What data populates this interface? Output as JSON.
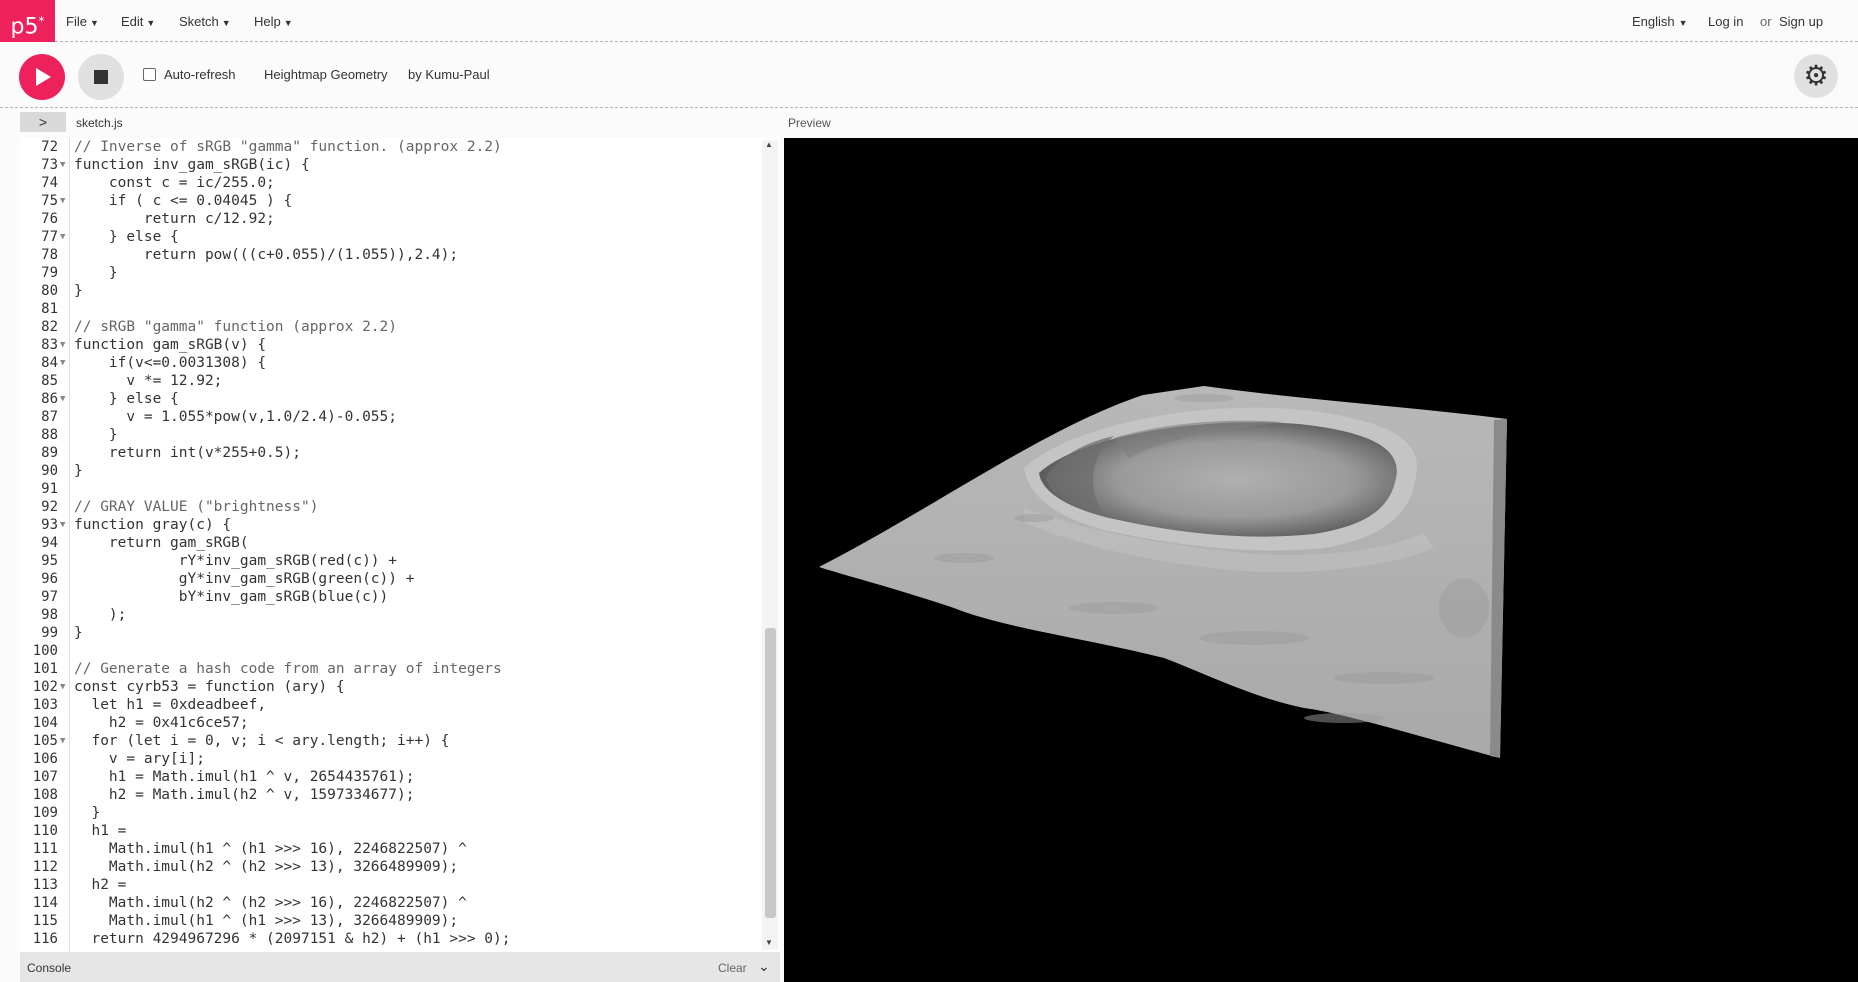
{
  "nav": {
    "logo": "p5",
    "logo_sup": "*",
    "menus": [
      "File",
      "Edit",
      "Sketch",
      "Help"
    ],
    "language": "English",
    "login": "Log in",
    "or": "or",
    "signup": "Sign up"
  },
  "toolbar": {
    "auto_refresh_label": "Auto-refresh",
    "auto_refresh_checked": false,
    "sketch_name": "Heightmap Geometry",
    "sketch_owner": "by Kumu-Paul"
  },
  "editor": {
    "file_name": "sketch.js",
    "preview_label": "Preview",
    "lines": [
      {
        "n": "72",
        "fold": "",
        "text": "// Inverse of sRGB \"gamma\" function. (approx 2.2)"
      },
      {
        "n": "73",
        "fold": "▼",
        "text": "function inv_gam_sRGB(ic) {"
      },
      {
        "n": "74",
        "fold": "",
        "text": "    const c = ic/255.0;"
      },
      {
        "n": "75",
        "fold": "▼",
        "text": "    if ( c <= 0.04045 ) {"
      },
      {
        "n": "76",
        "fold": "",
        "text": "        return c/12.92;"
      },
      {
        "n": "77",
        "fold": "▼",
        "text": "    } else {"
      },
      {
        "n": "78",
        "fold": "",
        "text": "        return pow(((c+0.055)/(1.055)),2.4);"
      },
      {
        "n": "79",
        "fold": "",
        "text": "    }"
      },
      {
        "n": "80",
        "fold": "",
        "text": "}"
      },
      {
        "n": "81",
        "fold": "",
        "text": ""
      },
      {
        "n": "82",
        "fold": "",
        "text": "// sRGB \"gamma\" function (approx 2.2)"
      },
      {
        "n": "83",
        "fold": "▼",
        "text": "function gam_sRGB(v) {"
      },
      {
        "n": "84",
        "fold": "▼",
        "text": "    if(v<=0.0031308) {"
      },
      {
        "n": "85",
        "fold": "",
        "text": "      v *= 12.92;"
      },
      {
        "n": "86",
        "fold": "▼",
        "text": "    } else {"
      },
      {
        "n": "87",
        "fold": "",
        "text": "      v = 1.055*pow(v,1.0/2.4)-0.055;"
      },
      {
        "n": "88",
        "fold": "",
        "text": "    }"
      },
      {
        "n": "89",
        "fold": "",
        "text": "    return int(v*255+0.5);"
      },
      {
        "n": "90",
        "fold": "",
        "text": "}"
      },
      {
        "n": "91",
        "fold": "",
        "text": ""
      },
      {
        "n": "92",
        "fold": "",
        "text": "// GRAY VALUE (\"brightness\")"
      },
      {
        "n": "93",
        "fold": "▼",
        "text": "function gray(c) {"
      },
      {
        "n": "94",
        "fold": "",
        "text": "    return gam_sRGB("
      },
      {
        "n": "95",
        "fold": "",
        "text": "            rY*inv_gam_sRGB(red(c)) +"
      },
      {
        "n": "96",
        "fold": "",
        "text": "            gY*inv_gam_sRGB(green(c)) +"
      },
      {
        "n": "97",
        "fold": "",
        "text": "            bY*inv_gam_sRGB(blue(c))"
      },
      {
        "n": "98",
        "fold": "",
        "text": "    );"
      },
      {
        "n": "99",
        "fold": "",
        "text": "}"
      },
      {
        "n": "100",
        "fold": "",
        "text": ""
      },
      {
        "n": "101",
        "fold": "",
        "text": "// Generate a hash code from an array of integers"
      },
      {
        "n": "102",
        "fold": "▼",
        "text": "const cyrb53 = function (ary) {"
      },
      {
        "n": "103",
        "fold": "",
        "text": "  let h1 = 0xdeadbeef,"
      },
      {
        "n": "104",
        "fold": "",
        "text": "    h2 = 0x41c6ce57;"
      },
      {
        "n": "105",
        "fold": "▼",
        "text": "  for (let i = 0, v; i < ary.length; i++) {"
      },
      {
        "n": "106",
        "fold": "",
        "text": "    v = ary[i];"
      },
      {
        "n": "107",
        "fold": "",
        "text": "    h1 = Math.imul(h1 ^ v, 2654435761);"
      },
      {
        "n": "108",
        "fold": "",
        "text": "    h2 = Math.imul(h2 ^ v, 1597334677);"
      },
      {
        "n": "109",
        "fold": "",
        "text": "  }"
      },
      {
        "n": "110",
        "fold": "",
        "text": "  h1 ="
      },
      {
        "n": "111",
        "fold": "",
        "text": "    Math.imul(h1 ^ (h1 >>> 16), 2246822507) ^"
      },
      {
        "n": "112",
        "fold": "",
        "text": "    Math.imul(h2 ^ (h2 >>> 13), 3266489909);"
      },
      {
        "n": "113",
        "fold": "",
        "text": "  h2 ="
      },
      {
        "n": "114",
        "fold": "",
        "text": "    Math.imul(h2 ^ (h2 >>> 16), 2246822507) ^"
      },
      {
        "n": "115",
        "fold": "",
        "text": "    Math.imul(h1 ^ (h1 >>> 13), 3266489909);"
      },
      {
        "n": "116",
        "fold": "",
        "text": "  return 4294967296 * (2097151 & h2) + (h1 >>> 0);"
      }
    ]
  },
  "console": {
    "title": "Console",
    "clear": "Clear"
  },
  "colors": {
    "accent": "#ed225d",
    "preview_bg": "#000000",
    "comment": "#666666",
    "keyword": "#704f21",
    "builtin": "#0b7ca9"
  }
}
